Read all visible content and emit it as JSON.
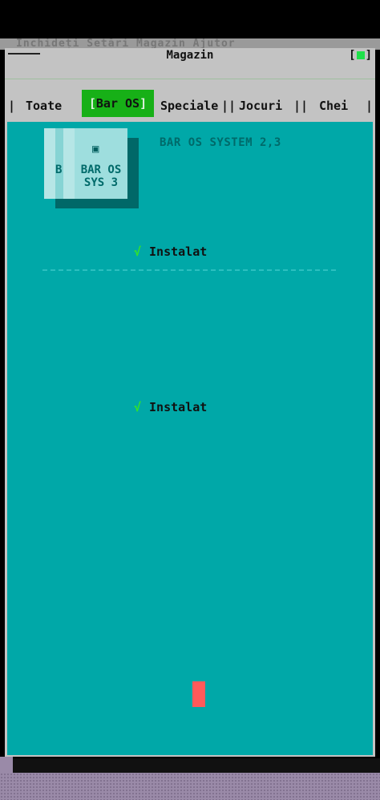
{
  "behind_menu_text": "  Închideți  Setări  Magazin  Ajutor",
  "window": {
    "title": "Magazin",
    "controls_left": "[",
    "controls_right": "]"
  },
  "tabs": [
    {
      "label": "Toate"
    },
    {
      "label": "Bar OS",
      "active": true
    },
    {
      "label": "Speciale"
    },
    {
      "label": "Jocuri"
    },
    {
      "label": "Chei"
    }
  ],
  "tab_bracket_left": "[",
  "tab_bracket_right": "]",
  "tab_separator": "|",
  "tab_separator_double": "||",
  "app": {
    "icon_glyph": "▣",
    "icon_side_letter": "B",
    "icon_label_line1": "BAR OS",
    "icon_label_line2": "SYS 3",
    "name": "BAR OS SYSTEM 2,3"
  },
  "items": [
    {
      "check": "√",
      "status": "Instalat"
    },
    {
      "check": "√",
      "status": "Instalat"
    }
  ],
  "colors": {
    "content_bg": "#00a8a8",
    "active_tab": "#17b017",
    "check": "#30e030",
    "cursor": "#ff5a5a"
  }
}
